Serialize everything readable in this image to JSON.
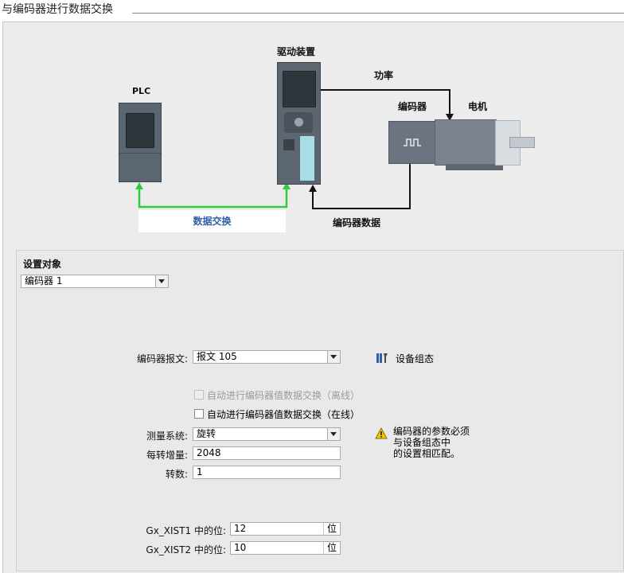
{
  "section_title": "与编码器进行数据交换",
  "diagram": {
    "plc_label": "PLC",
    "drive_label": "驱动装置",
    "power_label": "功率",
    "encoder_label": "编码器",
    "motor_label": "电机",
    "data_exchange_label": "数据交换",
    "encoder_data_label": "编码器数据",
    "colors": {
      "green_link": "#2ecc40",
      "black_link": "#111111",
      "device": "#5c6670",
      "motor": "#6b7480"
    }
  },
  "config": {
    "title": "设置对象",
    "object_select": {
      "value": "编码器 1"
    },
    "telegram": {
      "label": "编码器报文:",
      "value": "报文 105"
    },
    "device_config_link": {
      "label": "设备组态",
      "icon": "tools-icon"
    },
    "auto_offline": {
      "label": "自动进行编码器值数据交换（离线）",
      "checked": false,
      "enabled": false
    },
    "auto_online": {
      "label": "自动进行编码器值数据交换（在线）",
      "checked": false,
      "enabled": true
    },
    "measure_system": {
      "label": "测量系统:",
      "value": "旋转"
    },
    "increments": {
      "label": "每转增量:",
      "value": "2048"
    },
    "revolutions": {
      "label": "转数:",
      "value": "1"
    },
    "warning": {
      "icon": "warning-icon",
      "line1": "编码器的参数必须",
      "line2": "与设备组态中",
      "line3": "的设置相匹配。"
    },
    "xist1": {
      "label": "Gx_XIST1 中的位:",
      "value": "12",
      "unit": "位"
    },
    "xist2": {
      "label": "Gx_XIST2 中的位:",
      "value": "10",
      "unit": "位"
    }
  }
}
